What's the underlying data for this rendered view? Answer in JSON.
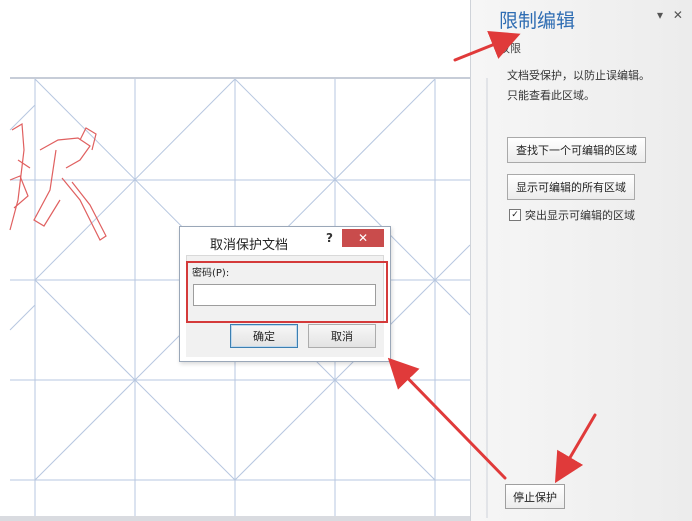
{
  "pane": {
    "title": "限制编辑",
    "minimize_glyph": "▾",
    "close_glyph": "✕",
    "section_label": "权限",
    "info_line1": "文档受保护，以防止误编辑。",
    "info_line2": "只能查看此区域。",
    "find_next_button": "查找下一个可编辑的区域",
    "show_all_button": "显示可编辑的所有区域",
    "highlight_checkbox_label": "突出显示可编辑的区域",
    "highlight_checked": true,
    "stop_button": "停止保护"
  },
  "dialog": {
    "title": "取消保护文档",
    "help_glyph": "?",
    "close_glyph": "✕",
    "password_label": "密码(P):",
    "password_value": "",
    "ok_button": "确定",
    "cancel_button": "取消"
  },
  "colors": {
    "accent_title": "#2f6db3",
    "annotation_red": "#e03a3a",
    "grid_line": "#b7c7e0",
    "calligraphy_outline": "#e06060"
  }
}
